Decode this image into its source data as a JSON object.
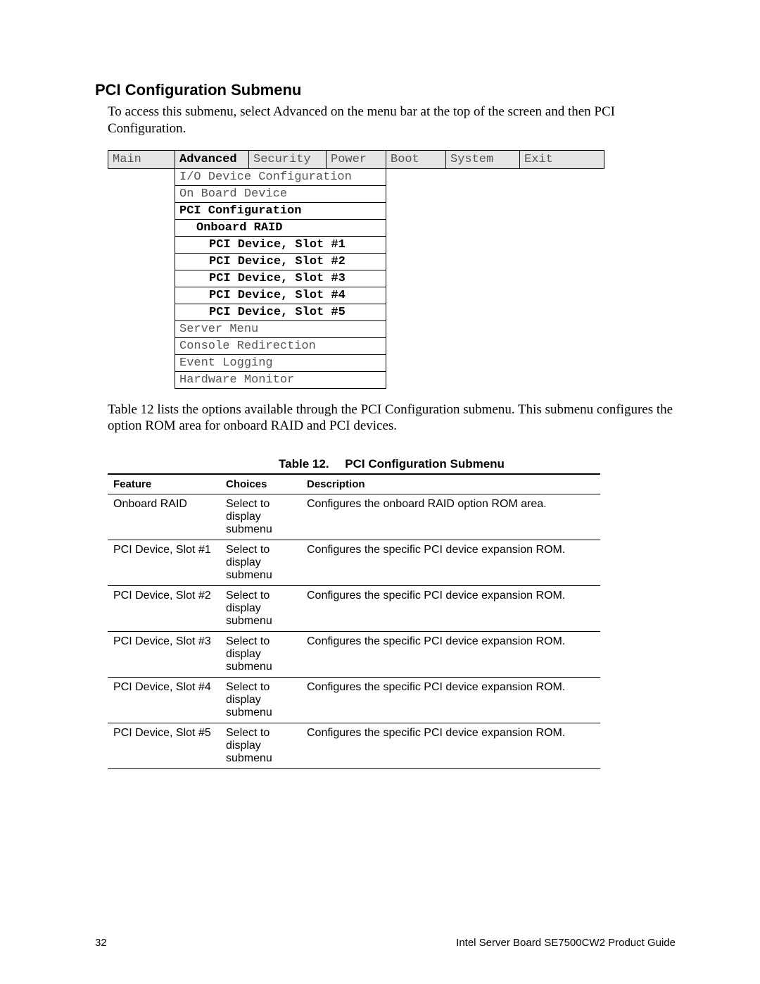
{
  "heading": "PCI Configuration Submenu",
  "intro": "To access this submenu, select Advanced on the menu bar at the top of the screen and then PCI Configuration.",
  "bios_menu": {
    "tabs": [
      "Main",
      "Advanced",
      "Security",
      "Power",
      "Boot",
      "System",
      "Exit"
    ],
    "active_index": 1,
    "items": [
      {
        "label": "I/O Device Configuration",
        "bold": false,
        "indent": 0
      },
      {
        "label": "On Board Device",
        "bold": false,
        "indent": 0
      },
      {
        "label": "PCI Configuration",
        "bold": true,
        "indent": 0
      },
      {
        "label": "Onboard RAID",
        "bold": true,
        "indent": 1
      },
      {
        "label": "PCI Device, Slot #1",
        "bold": true,
        "indent": 2
      },
      {
        "label": "PCI Device, Slot #2",
        "bold": true,
        "indent": 2
      },
      {
        "label": "PCI Device, Slot #3",
        "bold": true,
        "indent": 2
      },
      {
        "label": "PCI Device, Slot #4",
        "bold": true,
        "indent": 2
      },
      {
        "label": "PCI Device, Slot #5",
        "bold": true,
        "indent": 2
      },
      {
        "label": "Server Menu",
        "bold": false,
        "indent": 0
      },
      {
        "label": "Console Redirection",
        "bold": false,
        "indent": 0
      },
      {
        "label": "Event Logging",
        "bold": false,
        "indent": 0
      },
      {
        "label": "Hardware Monitor",
        "bold": false,
        "indent": 0
      }
    ]
  },
  "description": "Table 12 lists the options available through the PCI Configuration submenu.  This submenu configures the option ROM area for onboard RAID and PCI devices.",
  "table_caption_num": "Table 12.",
  "table_caption_title": "PCI Configuration Submenu",
  "feat_headers": {
    "c1": "Feature",
    "c2": "Choices",
    "c3": "Description"
  },
  "feat_rows": [
    {
      "feature": "Onboard RAID",
      "choices": "Select to display submenu",
      "description": "Configures the onboard RAID option ROM area."
    },
    {
      "feature": "PCI Device, Slot #1",
      "choices": "Select to display submenu",
      "description": "Configures the specific PCI device expansion ROM."
    },
    {
      "feature": "PCI Device, Slot #2",
      "choices": "Select to display submenu",
      "description": "Configures the specific PCI device expansion ROM."
    },
    {
      "feature": "PCI Device, Slot #3",
      "choices": "Select to display submenu",
      "description": "Configures the specific PCI device expansion ROM."
    },
    {
      "feature": "PCI Device, Slot #4",
      "choices": "Select to display submenu",
      "description": "Configures the specific PCI device expansion ROM."
    },
    {
      "feature": "PCI Device, Slot #5",
      "choices": "Select to display submenu",
      "description": "Configures the specific PCI device expansion ROM."
    }
  ],
  "footer": {
    "page": "32",
    "title": "Intel Server Board SE7500CW2 Product Guide"
  }
}
